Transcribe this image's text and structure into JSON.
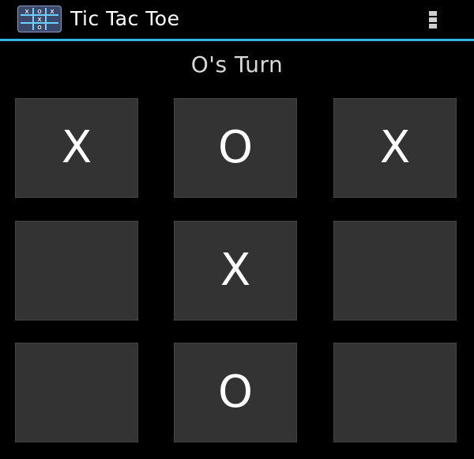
{
  "app_bar": {
    "title": "Tic Tac Toe",
    "icon": "tic-tac-toe-app-icon",
    "menu_icon": "overflow-menu-icon",
    "accent_color": "#33b5e5"
  },
  "status": {
    "turn_text": "O's Turn"
  },
  "board": {
    "cells": [
      "X",
      "O",
      "X",
      "",
      "X",
      "",
      "",
      "O",
      ""
    ]
  }
}
